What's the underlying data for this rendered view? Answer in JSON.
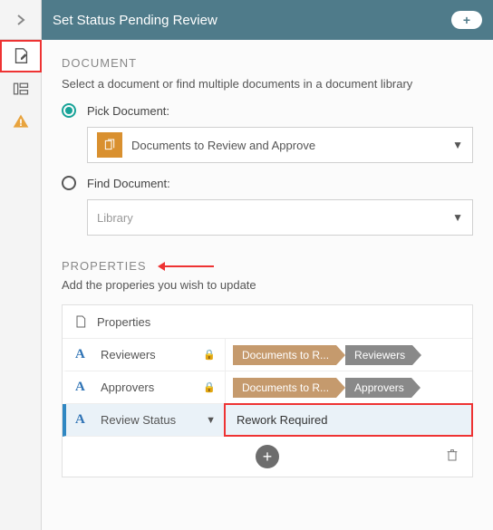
{
  "header": {
    "title": "Set Status Pending Review"
  },
  "document": {
    "section_title": "DOCUMENT",
    "subtitle": "Select a document or find multiple documents in a document library",
    "pick_label": "Pick Document:",
    "pick_value": "Documents to Review and Approve",
    "find_label": "Find Document:",
    "find_value": "Library"
  },
  "properties": {
    "section_title": "PROPERTIES",
    "subtitle": "Add the properies you wish to update",
    "header_label": "Properties",
    "rows": [
      {
        "key": "Reviewers",
        "tag1": "Documents to R...",
        "tag2": "Reviewers"
      },
      {
        "key": "Approvers",
        "tag1": "Documents to R...",
        "tag2": "Approvers"
      },
      {
        "key": "Review Status",
        "value": "Rework Required"
      }
    ]
  }
}
